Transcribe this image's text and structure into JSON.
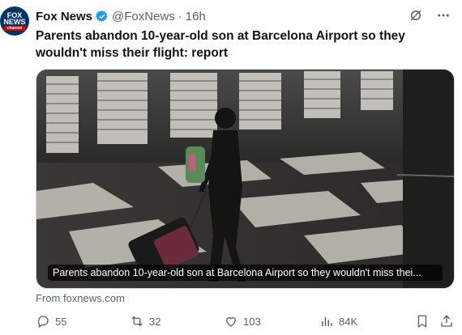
{
  "account": {
    "name": "Fox News",
    "handle": "@FoxNews",
    "separator": "·",
    "time": "16h",
    "avatar_text_line1": "FOX",
    "avatar_text_line2": "NEWS",
    "avatar_text_line3": "channel"
  },
  "tweet": {
    "text": "Parents abandon 10-year-old son at Barcelona Airport so they wouldn't miss their flight: report"
  },
  "media": {
    "caption": "Parents abandon 10-year-old son at Barcelona Airport so they wouldn't miss thei..."
  },
  "link": {
    "source": "From foxnews.com"
  },
  "actions": {
    "replies": "55",
    "reposts": "32",
    "likes": "103",
    "views": "84K"
  },
  "colors": {
    "accent": "#1d9bf0",
    "muted": "#536471",
    "text": "#0f1419"
  },
  "icons": [
    "verified-badge-icon",
    "grok-icon",
    "more-icon",
    "reply-icon",
    "repost-icon",
    "like-icon",
    "views-icon",
    "bookmark-icon",
    "share-icon"
  ]
}
